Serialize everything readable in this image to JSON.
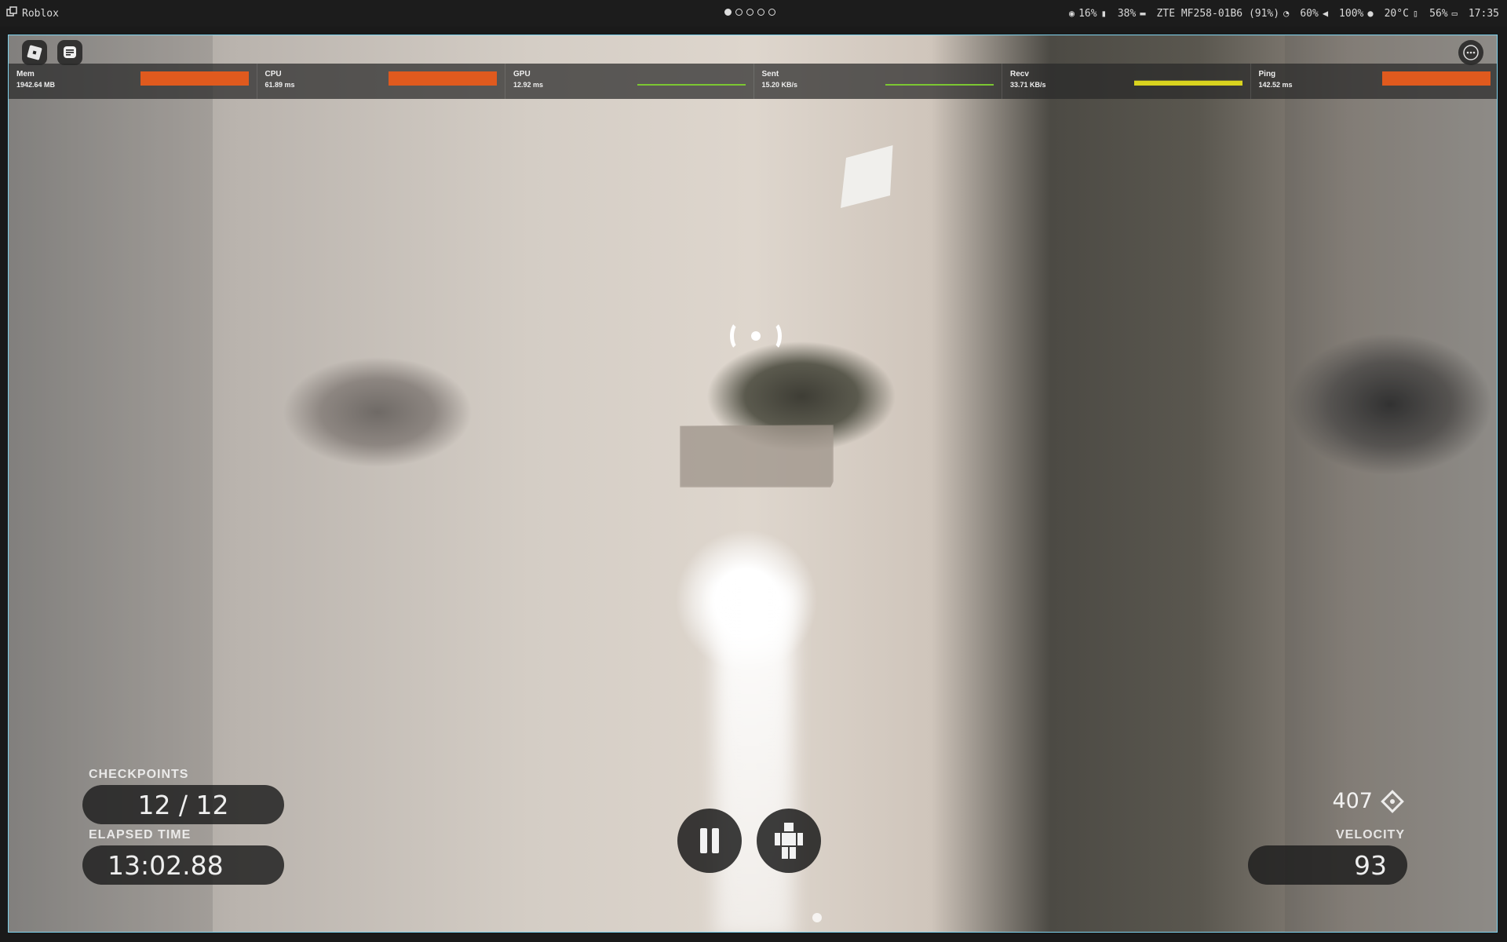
{
  "system_bar": {
    "app_name": "Roblox",
    "workspaces": 5,
    "active_workspace": 1,
    "status": [
      {
        "icon": "eye-off-icon",
        "text": "16%"
      },
      {
        "icon": "battery-icon",
        "text": "38%"
      },
      {
        "icon": "network-icon",
        "text": "ZTE MF258-01B6 (91%)"
      },
      {
        "icon": "brightness-icon",
        "text": "60%"
      },
      {
        "icon": "volume-icon",
        "text": "100%"
      },
      {
        "icon": "temperature-icon",
        "text": "20°C"
      },
      {
        "icon": "cpu-battery-icon",
        "text": "56%"
      },
      {
        "icon": "clock-icon",
        "text": "17:35"
      }
    ]
  },
  "perf_stats": [
    {
      "label": "Mem",
      "value": "1942.64 MB",
      "bar_color": "#e05a1e",
      "level": 1.0
    },
    {
      "label": "CPU",
      "value": "61.89 ms",
      "bar_color": "#e05a1e",
      "level": 1.0
    },
    {
      "label": "GPU",
      "value": "12.92 ms",
      "bar_color": "#7cc732",
      "level": 0.08
    },
    {
      "label": "Sent",
      "value": "15.20 KB/s",
      "bar_color": "#7cc732",
      "level": 0.05
    },
    {
      "label": "Recv",
      "value": "33.71 KB/s",
      "bar_color": "#d9d31e",
      "level": 0.35
    },
    {
      "label": "Ping",
      "value": "142.52 ms",
      "bar_color": "#e05a1e",
      "level": 1.0
    }
  ],
  "hud": {
    "checkpoints_label": "CHECKPOINTS",
    "checkpoints_value": "12 / 12",
    "elapsed_label": "ELAPSED TIME",
    "elapsed_value": "13:02.88",
    "score": "407",
    "velocity_label": "VELOCITY",
    "velocity_value": "93"
  },
  "colors": {
    "window_border": "#7fd3ee",
    "pill_bg": "#1c1c1c"
  }
}
